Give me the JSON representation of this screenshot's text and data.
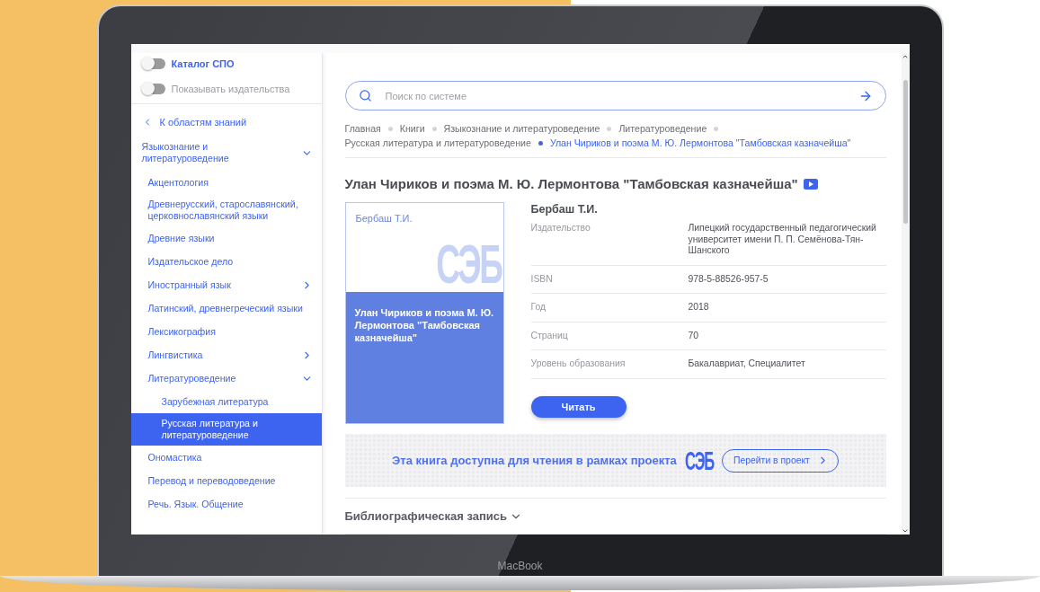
{
  "sidebar": {
    "toggles": [
      {
        "label": "Каталог СПО",
        "on": false,
        "bold": true
      },
      {
        "label": "Показывать издательства",
        "on": false,
        "bold": false
      }
    ],
    "back_link": "К областям знаний",
    "tree": [
      {
        "label": "Языкознание и литературоведение",
        "expanded": true,
        "selected": false,
        "children": [
          {
            "label": "Акцентология",
            "selected": false
          },
          {
            "label": "Древнерусский, старославянский, церковнославянский языки",
            "selected": false
          },
          {
            "label": "Древние языки",
            "selected": false
          },
          {
            "label": "Издательское дело",
            "selected": false
          },
          {
            "label": "Иностранный язык",
            "expanded": false,
            "selected": false
          },
          {
            "label": "Латинский, древнегреческий языки",
            "selected": false
          },
          {
            "label": "Лексикография",
            "selected": false
          },
          {
            "label": "Лингвистика",
            "expanded": false,
            "selected": false
          },
          {
            "label": "Литературоведение",
            "expanded": true,
            "selected": false,
            "children": [
              {
                "label": "Зарубежная литература",
                "selected": false
              },
              {
                "label": "Русская литература и литературоведение",
                "selected": true
              }
            ]
          },
          {
            "label": "Ономастика",
            "selected": false
          },
          {
            "label": "Перевод и переводоведение",
            "selected": false
          },
          {
            "label": "Речь. Язык. Общение",
            "selected": false
          }
        ]
      }
    ]
  },
  "search": {
    "placeholder": "Поиск по системе"
  },
  "breadcrumbs": [
    {
      "label": "Главная",
      "current": false
    },
    {
      "label": "Книги",
      "current": false
    },
    {
      "label": "Языкознание и литературоведение",
      "current": false
    },
    {
      "label": "Литературоведение",
      "current": false
    },
    {
      "label": "Русская литература и литературоведение",
      "current": false
    },
    {
      "label": "Улан Чириков и поэма М. Ю. Лермонтова \"Тамбовская казначейша\"",
      "current": true
    }
  ],
  "title": "Улан Чириков и поэма М. Ю. Лермонтова \"Тамбовская казначейша\"",
  "cover": {
    "author": "Бербаш Т.И.",
    "watermark": "СЭБ",
    "title": "Улан Чириков и поэма М. Ю. Лермонтова \"Тамбовская казначейша\""
  },
  "author": "Бербаш Т.И.",
  "details": [
    {
      "label": "Издательство",
      "value": "Липецкий государственный педагогический университет имени П. П. Семёнова-Тян-Шанского"
    },
    {
      "label": "ISBN",
      "value": "978-5-88526-957-5"
    },
    {
      "label": "Год",
      "value": "2018"
    },
    {
      "label": "Страниц",
      "value": "70"
    },
    {
      "label": "Уровень образования",
      "value": "Бакалавриат, Специалитет"
    }
  ],
  "read_button": "Читать",
  "banner": {
    "text": "Эта книга доступна для чтения в рамках проекта",
    "logo": "СЭБ",
    "link": "Перейти в проект"
  },
  "bibliography": {
    "label": "Библиографическая запись",
    "expanded": false
  },
  "laptop_label": "MacBook"
}
